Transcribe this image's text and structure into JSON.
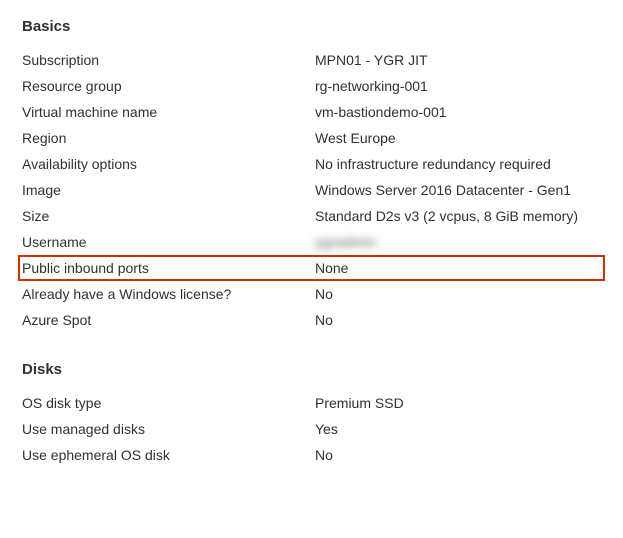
{
  "sections": {
    "basics": {
      "heading": "Basics",
      "items": [
        {
          "label": "Subscription",
          "value": "MPN01 - YGR JIT"
        },
        {
          "label": "Resource group",
          "value": "rg-networking-001"
        },
        {
          "label": "Virtual machine name",
          "value": "vm-bastiondemo-001"
        },
        {
          "label": "Region",
          "value": "West Europe"
        },
        {
          "label": "Availability options",
          "value": "No infrastructure redundancy required"
        },
        {
          "label": "Image",
          "value": "Windows Server 2016 Datacenter - Gen1"
        },
        {
          "label": "Size",
          "value": "Standard D2s v3 (2 vcpus, 8 GiB memory)"
        },
        {
          "label": "Username",
          "value": "ygradmin",
          "redacted": true
        },
        {
          "label": "Public inbound ports",
          "value": "None",
          "highlighted": true
        },
        {
          "label": "Already have a Windows license?",
          "value": "No"
        },
        {
          "label": "Azure Spot",
          "value": "No"
        }
      ]
    },
    "disks": {
      "heading": "Disks",
      "items": [
        {
          "label": "OS disk type",
          "value": "Premium SSD"
        },
        {
          "label": "Use managed disks",
          "value": "Yes"
        },
        {
          "label": "Use ephemeral OS disk",
          "value": "No"
        }
      ]
    }
  }
}
